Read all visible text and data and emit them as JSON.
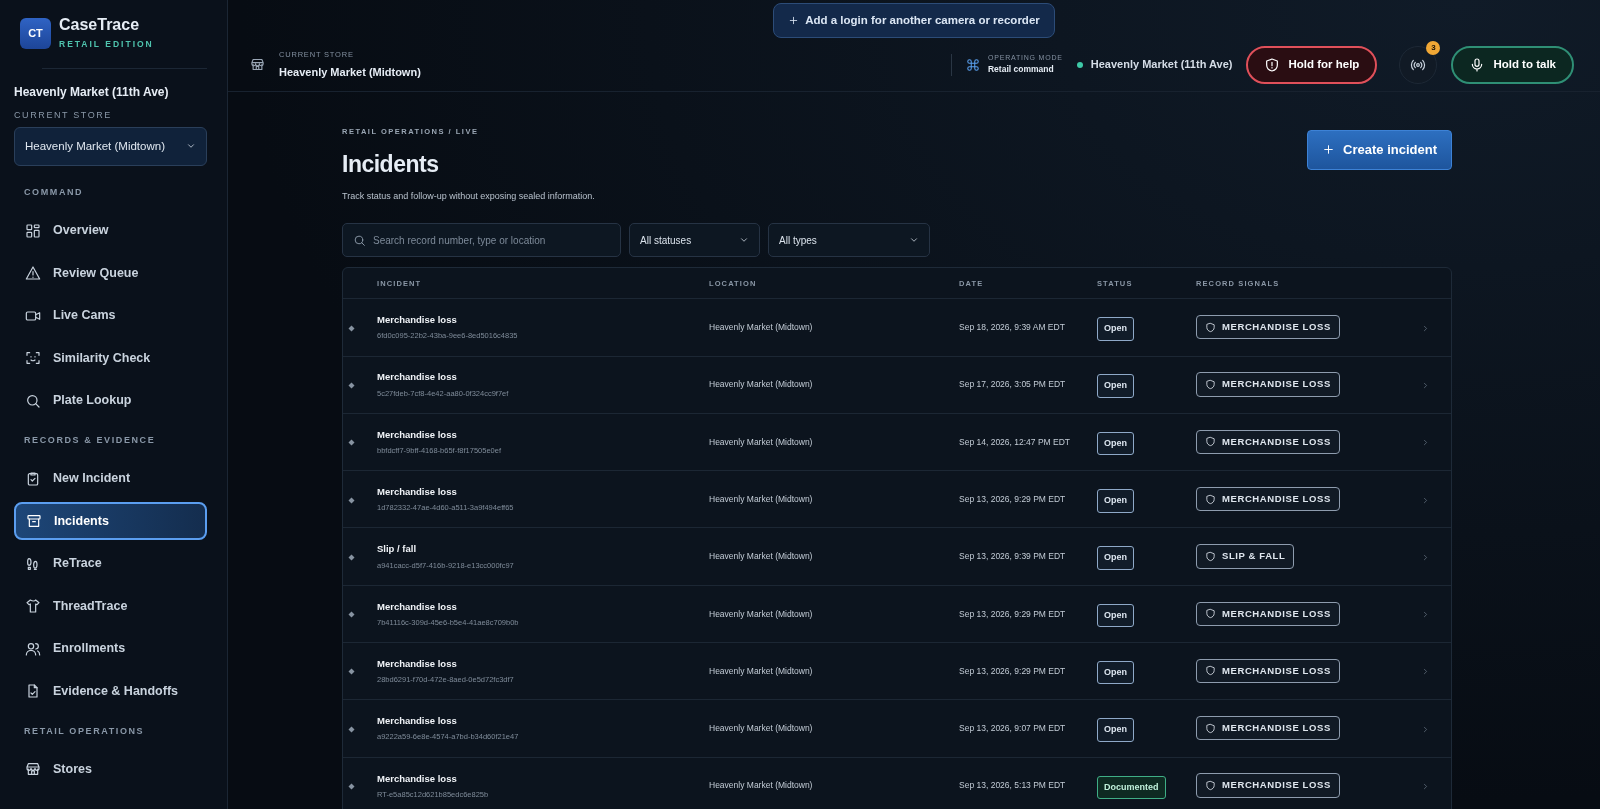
{
  "brand": {
    "logo": "CT",
    "name": "CaseTrace",
    "edition": "RETAIL EDITION"
  },
  "sidebar": {
    "store_name": "Heavenly Market (11th Ave)",
    "store_label": "CURRENT STORE",
    "store_select": "Heavenly Market (Midtown)",
    "sections": [
      {
        "label": "COMMAND",
        "items": [
          {
            "label": "Overview",
            "selected": false
          },
          {
            "label": "Review Queue",
            "selected": false
          },
          {
            "label": "Live Cams",
            "selected": false
          },
          {
            "label": "Similarity Check",
            "selected": false
          },
          {
            "label": "Plate Lookup",
            "selected": false
          }
        ]
      },
      {
        "label": "RECORDS & EVIDENCE",
        "items": [
          {
            "label": "New Incident",
            "selected": false
          },
          {
            "label": "Incidents",
            "selected": true
          },
          {
            "label": "ReTrace",
            "selected": false
          },
          {
            "label": "ThreadTrace",
            "selected": false
          },
          {
            "label": "Enrollments",
            "selected": false
          },
          {
            "label": "Evidence & Handoffs",
            "selected": false
          }
        ]
      },
      {
        "label": "RETAIL OPERATIONS",
        "items": [
          {
            "label": "Stores",
            "selected": false
          }
        ]
      }
    ]
  },
  "add_login_button": "Add a login for another camera or recorder",
  "header": {
    "store_label": "CURRENT STORE",
    "store_name": "Heavenly Market (Midtown)",
    "mode_label": "OPERATING MODE",
    "mode_value": "Retail command",
    "site": "Heavenly Market (11th Ave)",
    "help_button": "Hold for help",
    "alerts_count": "3",
    "talk_button": "Hold to talk"
  },
  "page": {
    "breadcrumb": "RETAIL OPERATIONS / LIVE",
    "title": "Incidents",
    "subtitle": "Track status and follow-up without exposing sealed information.",
    "create_button": "Create incident"
  },
  "filters": {
    "search_placeholder": "Search record number, type or location",
    "status_select": "All statuses",
    "type_select": "All types"
  },
  "table": {
    "columns": [
      "INCIDENT",
      "LOCATION",
      "DATE",
      "STATUS",
      "RECORD SIGNALS"
    ],
    "rows": [
      {
        "type": "Merchandise loss",
        "id": "6fd0c095-22b2-43ba-9ee6-8ed5016c4835",
        "location": "Heavenly Market (Midtown)",
        "date": "Sep 18, 2026, 9:39 AM EDT",
        "status": "Open",
        "kind": "open",
        "signal": "MERCHANDISE LOSS"
      },
      {
        "type": "Merchandise loss",
        "id": "5c27fdeb-7cf8-4e42-aa80-0f324cc9f7ef",
        "location": "Heavenly Market (Midtown)",
        "date": "Sep 17, 2026, 3:05 PM EDT",
        "status": "Open",
        "kind": "open",
        "signal": "MERCHANDISE LOSS"
      },
      {
        "type": "Merchandise loss",
        "id": "bbfdcff7-9bff-4168-b65f-f8f17505e0ef",
        "location": "Heavenly Market (Midtown)",
        "date": "Sep 14, 2026, 12:47 PM EDT",
        "status": "Open",
        "kind": "open",
        "signal": "MERCHANDISE LOSS"
      },
      {
        "type": "Merchandise loss",
        "id": "1d782332-47ae-4d60-a511-3a9f494eff65",
        "location": "Heavenly Market (Midtown)",
        "date": "Sep 13, 2026, 9:29 PM EDT",
        "status": "Open",
        "kind": "open",
        "signal": "MERCHANDISE LOSS"
      },
      {
        "type": "Slip / fall",
        "id": "a941cacc-d5f7-416b-9218-e13cc000fc97",
        "location": "Heavenly Market (Midtown)",
        "date": "Sep 13, 2026, 9:39 PM EDT",
        "status": "Open",
        "kind": "open",
        "signal": "SLIP & FALL"
      },
      {
        "type": "Merchandise loss",
        "id": "7b41116c-309d-45e6-b5e4-41ae8c709b0b",
        "location": "Heavenly Market (Midtown)",
        "date": "Sep 13, 2026, 9:29 PM EDT",
        "status": "Open",
        "kind": "open",
        "signal": "MERCHANDISE LOSS"
      },
      {
        "type": "Merchandise loss",
        "id": "28bd6291-f70d-472e-8aed-0e5d72fc3df7",
        "location": "Heavenly Market (Midtown)",
        "date": "Sep 13, 2026, 9:29 PM EDT",
        "status": "Open",
        "kind": "open",
        "signal": "MERCHANDISE LOSS"
      },
      {
        "type": "Merchandise loss",
        "id": "a9222a59-6e8e-4574-a7bd-b34d60f21e47",
        "location": "Heavenly Market (Midtown)",
        "date": "Sep 13, 2026, 9:07 PM EDT",
        "status": "Open",
        "kind": "open",
        "signal": "MERCHANDISE LOSS"
      },
      {
        "type": "Merchandise loss",
        "id": "RT-e5a85c12d621b85edc6e825b",
        "location": "Heavenly Market (Midtown)",
        "date": "Sep 13, 2026, 5:13 PM EDT",
        "status": "Documented",
        "kind": "documented",
        "signal": "MERCHANDISE LOSS"
      }
    ]
  }
}
